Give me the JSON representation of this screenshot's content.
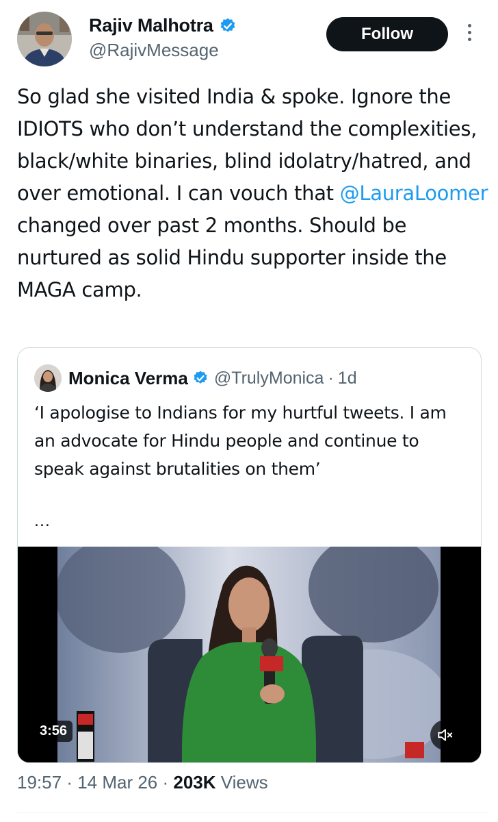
{
  "author": {
    "name": "Rajiv Malhotra",
    "handle": "@RajivMessage",
    "verified": true
  },
  "follow_label": "Follow",
  "tweet": {
    "text_before_mention": "So glad she visited India & spoke. Ignore the IDIOTS who don’t understand the complexities, black/white binaries, blind idolatry/hatred, and over emotional. I can vouch that ",
    "mention": "@LauraLoomer",
    "text_after_mention": " changed over past 2 months. Should be nurtured as solid Hindu supporter inside the MAGA camp."
  },
  "quoted": {
    "name": "Monica Verma",
    "handle": "@TrulyMonica",
    "separator": "·",
    "time": "1d",
    "text": "‘I apologise to Indians for my hurtful tweets. I am an advocate for Hindu people and continue to speak against brutalities on them’",
    "ellipsis": "...",
    "video": {
      "duration": "3:56",
      "muted": true
    }
  },
  "meta": {
    "time": "19:57",
    "sep1": " · ",
    "date": "14 Mar 26",
    "sep2": " · ",
    "views_count": "203K",
    "views_label": " Views"
  },
  "colors": {
    "text": "#0f1419",
    "secondary": "#536471",
    "link": "#1d9bf0",
    "verified": "#1d9bf0",
    "follow_bg": "#0f1419",
    "video_bg": "#000000"
  },
  "icons": [
    "verified-badge-icon",
    "more-options-icon",
    "mute-speaker-icon"
  ]
}
